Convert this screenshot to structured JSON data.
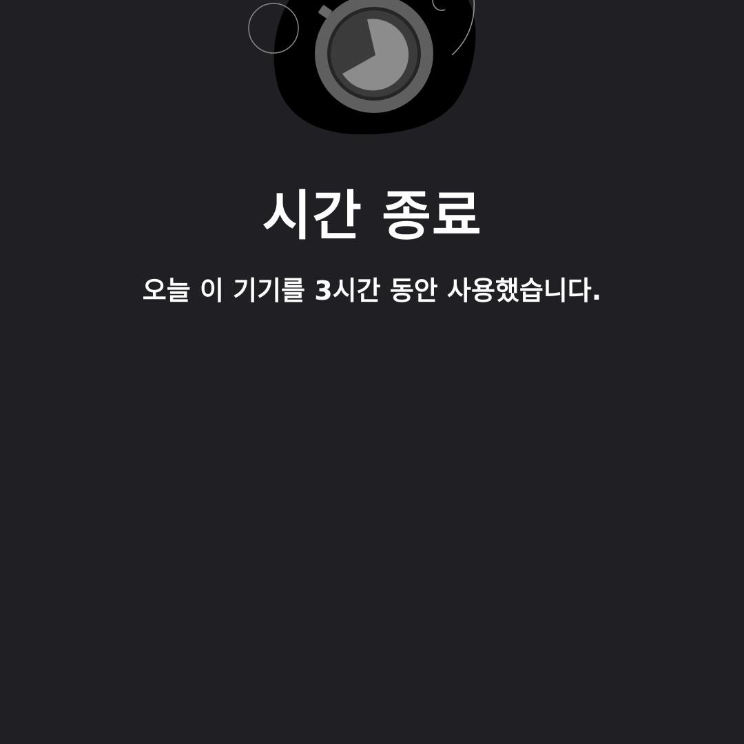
{
  "screen": {
    "title": "시간 종료",
    "message": "오늘 이 기기를 3시간 동안 사용했습니다."
  },
  "illustration": {
    "icon": "stopwatch-icon",
    "blob_color": "#000000",
    "ring_color": "#5f5f5f",
    "face_color": "#3b3b3b",
    "pie_color": "#8c8c8c"
  },
  "colors": {
    "background": "#202024",
    "text": "#ffffff"
  }
}
